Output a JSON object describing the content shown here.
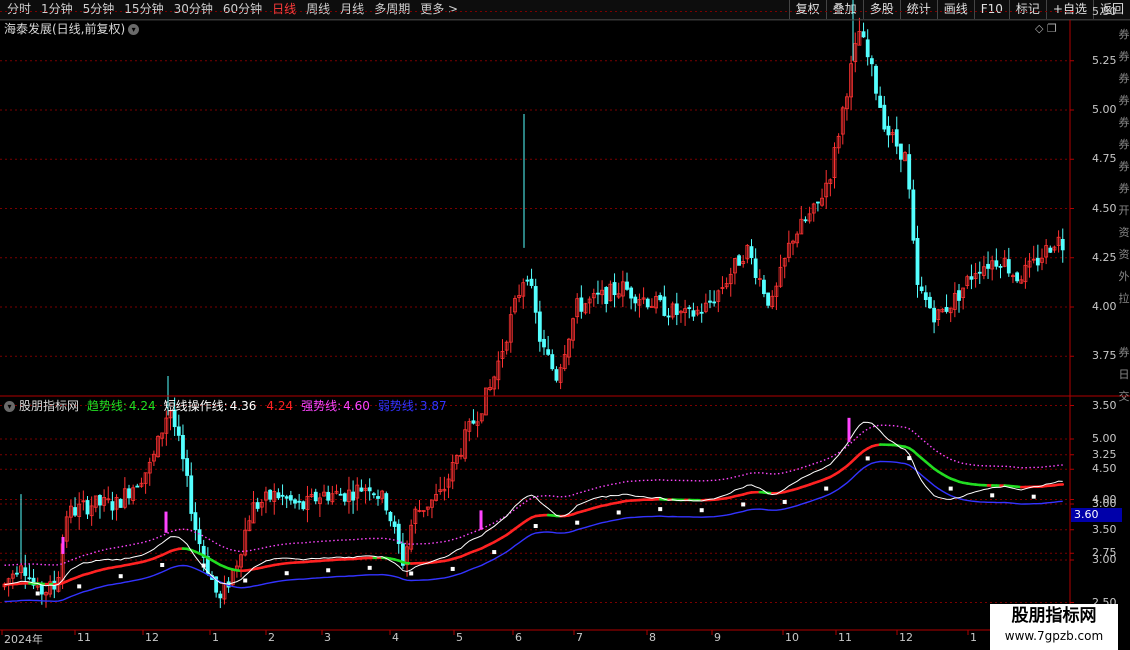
{
  "topbar": {
    "periods": [
      "分时",
      "1分钟",
      "5分钟",
      "15分钟",
      "30分钟",
      "60分钟",
      "日线",
      "周线",
      "月线",
      "多周期",
      "更多 >"
    ],
    "active_period": "日线",
    "buttons": [
      "复权",
      "叠加",
      "多股",
      "统计",
      "画线",
      "F10",
      "标记",
      "+自选",
      "返回"
    ]
  },
  "main_chart": {
    "title": "海泰发展(日线,前复权)",
    "corner_icons": [
      "◇",
      "❐"
    ],
    "y_ticks": [
      "5.50",
      "5.25",
      "5.00",
      "4.75",
      "4.50",
      "4.25",
      "4.00",
      "3.75",
      "3.50",
      "3.25",
      "3.00",
      "2.75",
      "2.50"
    ]
  },
  "sub_chart": {
    "title": "股朋指标网",
    "legend": [
      {
        "label": "趋势线:",
        "value": "4.24",
        "color": "#22dd22"
      },
      {
        "label": "短线操作线:",
        "value": "4.36",
        "color": "#ffffff"
      },
      {
        "label": "",
        "value": "4.24",
        "color": "#ff2222"
      },
      {
        "label": "强势线:",
        "value": "4.60",
        "color": "#ff44ff"
      },
      {
        "label": "弱势线:",
        "value": "3.87",
        "color": "#3333ff"
      }
    ],
    "y_ticks": [
      "5.00",
      "4.50",
      "4.00",
      "3.50",
      "3.00"
    ],
    "price_tag": "3.60"
  },
  "x_axis": {
    "labels": [
      "2024年",
      "11",
      "12",
      "1",
      "2",
      "3",
      "4",
      "5",
      "6",
      "7",
      "8",
      "9",
      "10",
      "11",
      "12",
      "1"
    ]
  },
  "sidebar": {
    "glyphs": [
      "券",
      "券",
      "券",
      "券",
      "券",
      "券",
      "券",
      "券",
      "开",
      "资",
      "资",
      "外",
      "拉",
      "券",
      "日",
      "交"
    ]
  },
  "watermark": {
    "line1": "股朋指标网",
    "line2": "www.7gpzb.com"
  },
  "colors": {
    "up": "#ff3232",
    "down": "#54ffff",
    "trend_up": "#ff2222",
    "trend_down": "#22dd22",
    "short": "#ffffff",
    "strong": "#ff44ff",
    "weak": "#3333ff",
    "grid": "#7a0000"
  }
}
